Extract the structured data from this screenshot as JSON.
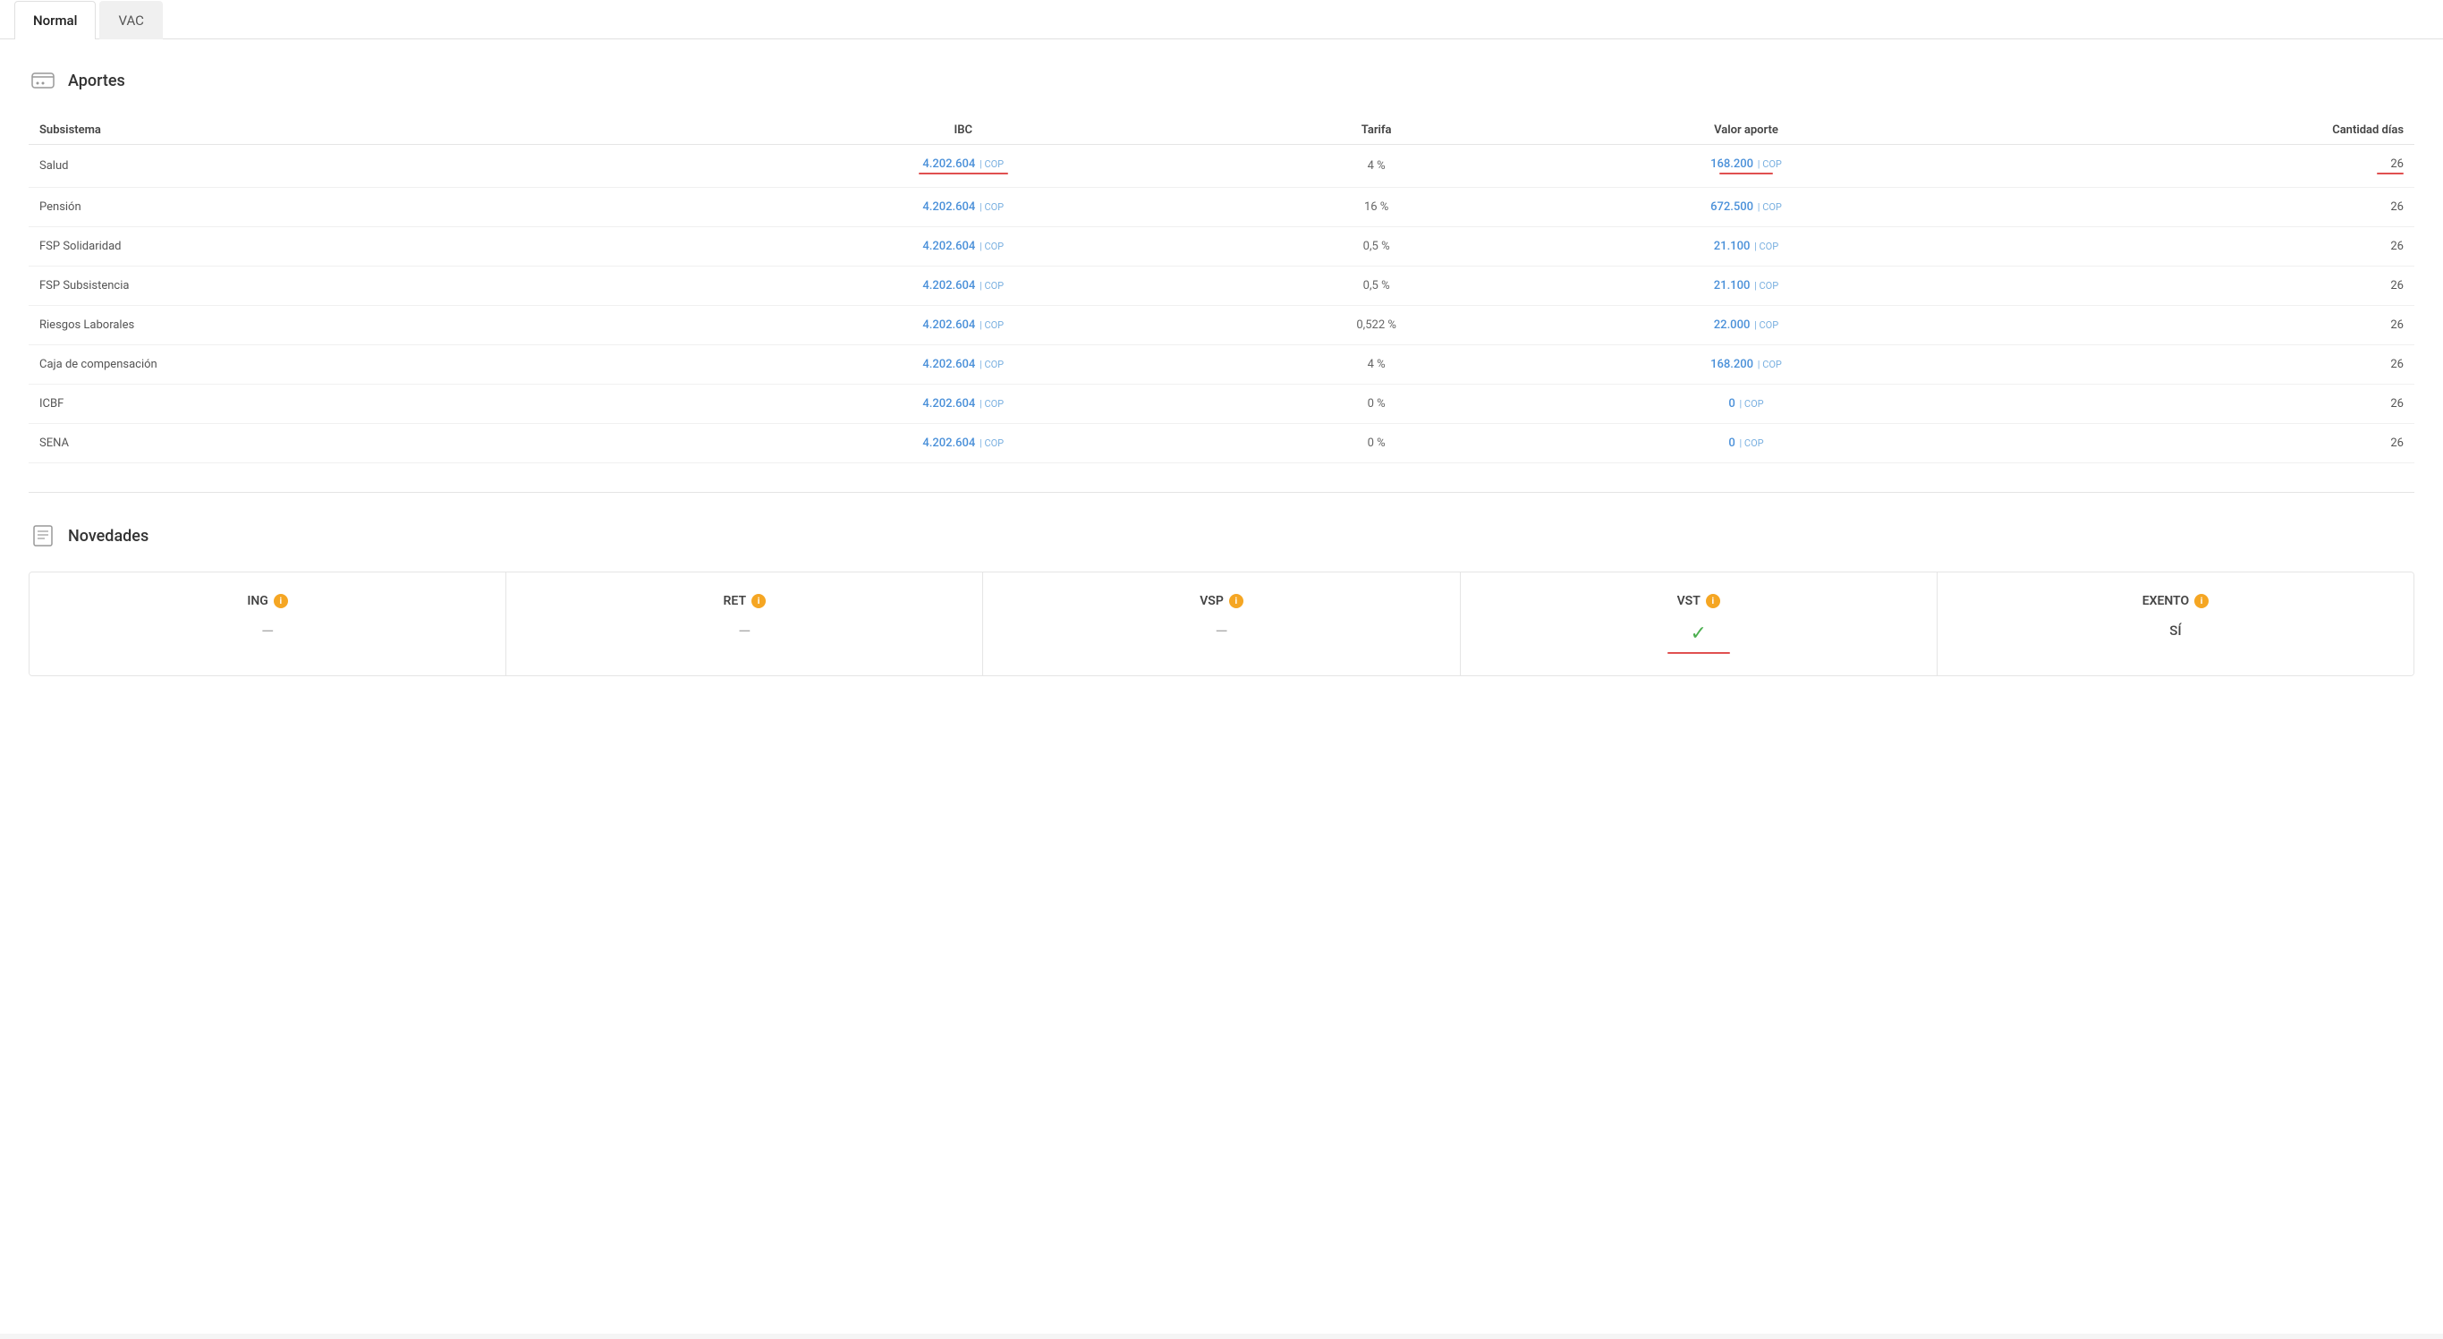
{
  "tabs": [
    {
      "id": "normal",
      "label": "Normal",
      "active": true
    },
    {
      "id": "vac",
      "label": "VAC",
      "active": false
    }
  ],
  "aportes": {
    "section_title": "Aportes",
    "columns": [
      "Subsistema",
      "IBC",
      "Tarifa",
      "Valor aporte",
      "Cantidad días"
    ],
    "rows": [
      {
        "subsistema": "Salud",
        "ibc_main": "4.202.604",
        "ibc_currency": "COP",
        "tarifa": "4 %",
        "valor_main": "168.200",
        "valor_currency": "COP",
        "cantidad": "26",
        "ibc_underline": true,
        "valor_underline": true,
        "cantidad_underline": true
      },
      {
        "subsistema": "Pensión",
        "ibc_main": "4.202.604",
        "ibc_currency": "COP",
        "tarifa": "16 %",
        "valor_main": "672.500",
        "valor_currency": "COP",
        "cantidad": "26",
        "ibc_underline": false,
        "valor_underline": false,
        "cantidad_underline": false
      },
      {
        "subsistema": "FSP Solidaridad",
        "ibc_main": "4.202.604",
        "ibc_currency": "COP",
        "tarifa": "0,5 %",
        "valor_main": "21.100",
        "valor_currency": "COP",
        "cantidad": "26",
        "ibc_underline": false,
        "valor_underline": false,
        "cantidad_underline": false
      },
      {
        "subsistema": "FSP Subsistencia",
        "ibc_main": "4.202.604",
        "ibc_currency": "COP",
        "tarifa": "0,5 %",
        "valor_main": "21.100",
        "valor_currency": "COP",
        "cantidad": "26",
        "ibc_underline": false,
        "valor_underline": false,
        "cantidad_underline": false
      },
      {
        "subsistema": "Riesgos Laborales",
        "ibc_main": "4.202.604",
        "ibc_currency": "COP",
        "tarifa": "0,522 %",
        "valor_main": "22.000",
        "valor_currency": "COP",
        "cantidad": "26",
        "ibc_underline": false,
        "valor_underline": false,
        "cantidad_underline": false
      },
      {
        "subsistema": "Caja de compensación",
        "ibc_main": "4.202.604",
        "ibc_currency": "COP",
        "tarifa": "4 %",
        "valor_main": "168.200",
        "valor_currency": "COP",
        "cantidad": "26",
        "ibc_underline": false,
        "valor_underline": false,
        "cantidad_underline": false
      },
      {
        "subsistema": "ICBF",
        "ibc_main": "4.202.604",
        "ibc_currency": "COP",
        "tarifa": "0 %",
        "valor_main": "0",
        "valor_currency": "COP",
        "cantidad": "26",
        "ibc_underline": false,
        "valor_underline": false,
        "cantidad_underline": false
      },
      {
        "subsistema": "SENA",
        "ibc_main": "4.202.604",
        "ibc_currency": "COP",
        "tarifa": "0 %",
        "valor_main": "0",
        "valor_currency": "COP",
        "cantidad": "26",
        "ibc_underline": false,
        "valor_underline": false,
        "cantidad_underline": false
      }
    ]
  },
  "novedades": {
    "section_title": "Novedades",
    "cards": [
      {
        "id": "ing",
        "label": "ING",
        "value": "—",
        "has_check": false,
        "has_underline": false,
        "is_si": false
      },
      {
        "id": "ret",
        "label": "RET",
        "value": "—",
        "has_check": false,
        "has_underline": false,
        "is_si": false
      },
      {
        "id": "vsp",
        "label": "VSP",
        "value": "—",
        "has_check": false,
        "has_underline": false,
        "is_si": false
      },
      {
        "id": "vst",
        "label": "VST",
        "value": "✓",
        "has_check": true,
        "has_underline": true,
        "is_si": false
      },
      {
        "id": "exento",
        "label": "EXENTO",
        "value": "SÍ",
        "has_check": false,
        "has_underline": false,
        "is_si": true
      }
    ]
  }
}
